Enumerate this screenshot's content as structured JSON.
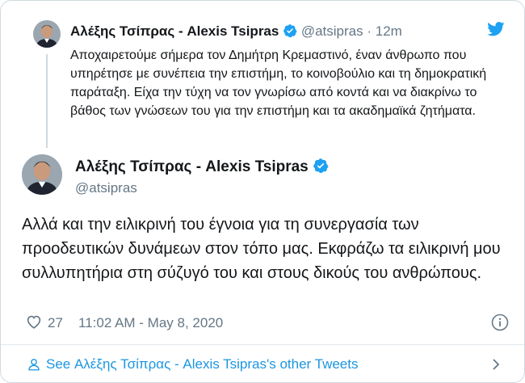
{
  "parent_tweet": {
    "name": "Αλέξης Τσίπρας - Alexis Tsipras",
    "handle": "@atsipras",
    "separator": "·",
    "time_ago": "12m",
    "text": "Αποχαιρετούμε σήμερα τον Δημήτρη Κρεμαστινό, έναν άνθρωπο που υπηρέτησε με συνέπεια την επιστήμη, το κοινοβούλιο και τη δημοκρατική παράταξη. Είχα την τύχη να τον γνωρίσω από κοντά και να διακρίνω το βάθος των γνώσεων του για την επιστήμη και τα ακαδημαϊκά ζητήματα."
  },
  "main_tweet": {
    "name": "Αλέξης Τσίπρας - Alexis Tsipras",
    "handle": "@atsipras",
    "text": "Αλλά και την ειλικρινή του έγνοια για τη συνεργασία των προοδευτικών δυνάμεων στον τόπο μας. Εκφράζω τα ειλικρινή μου συλλυπητήρια στη σύζυγό του και στους δικούς του ανθρώπους.",
    "like_count": "27",
    "timestamp": "11:02 AM - May 8, 2020"
  },
  "footer": {
    "label": "See Αλέξης Τσίπρας - Alexis Tsipras's other Tweets"
  },
  "icons": {
    "verified": "verified-badge-icon",
    "twitter": "twitter-bird-icon",
    "like": "heart-icon",
    "info": "info-icon",
    "person": "person-icon",
    "chevron": "chevron-right-icon"
  },
  "colors": {
    "brand_blue": "#1da1f2",
    "link_blue": "#1b95e0",
    "secondary_text": "#657786",
    "border": "#cfd9de"
  }
}
